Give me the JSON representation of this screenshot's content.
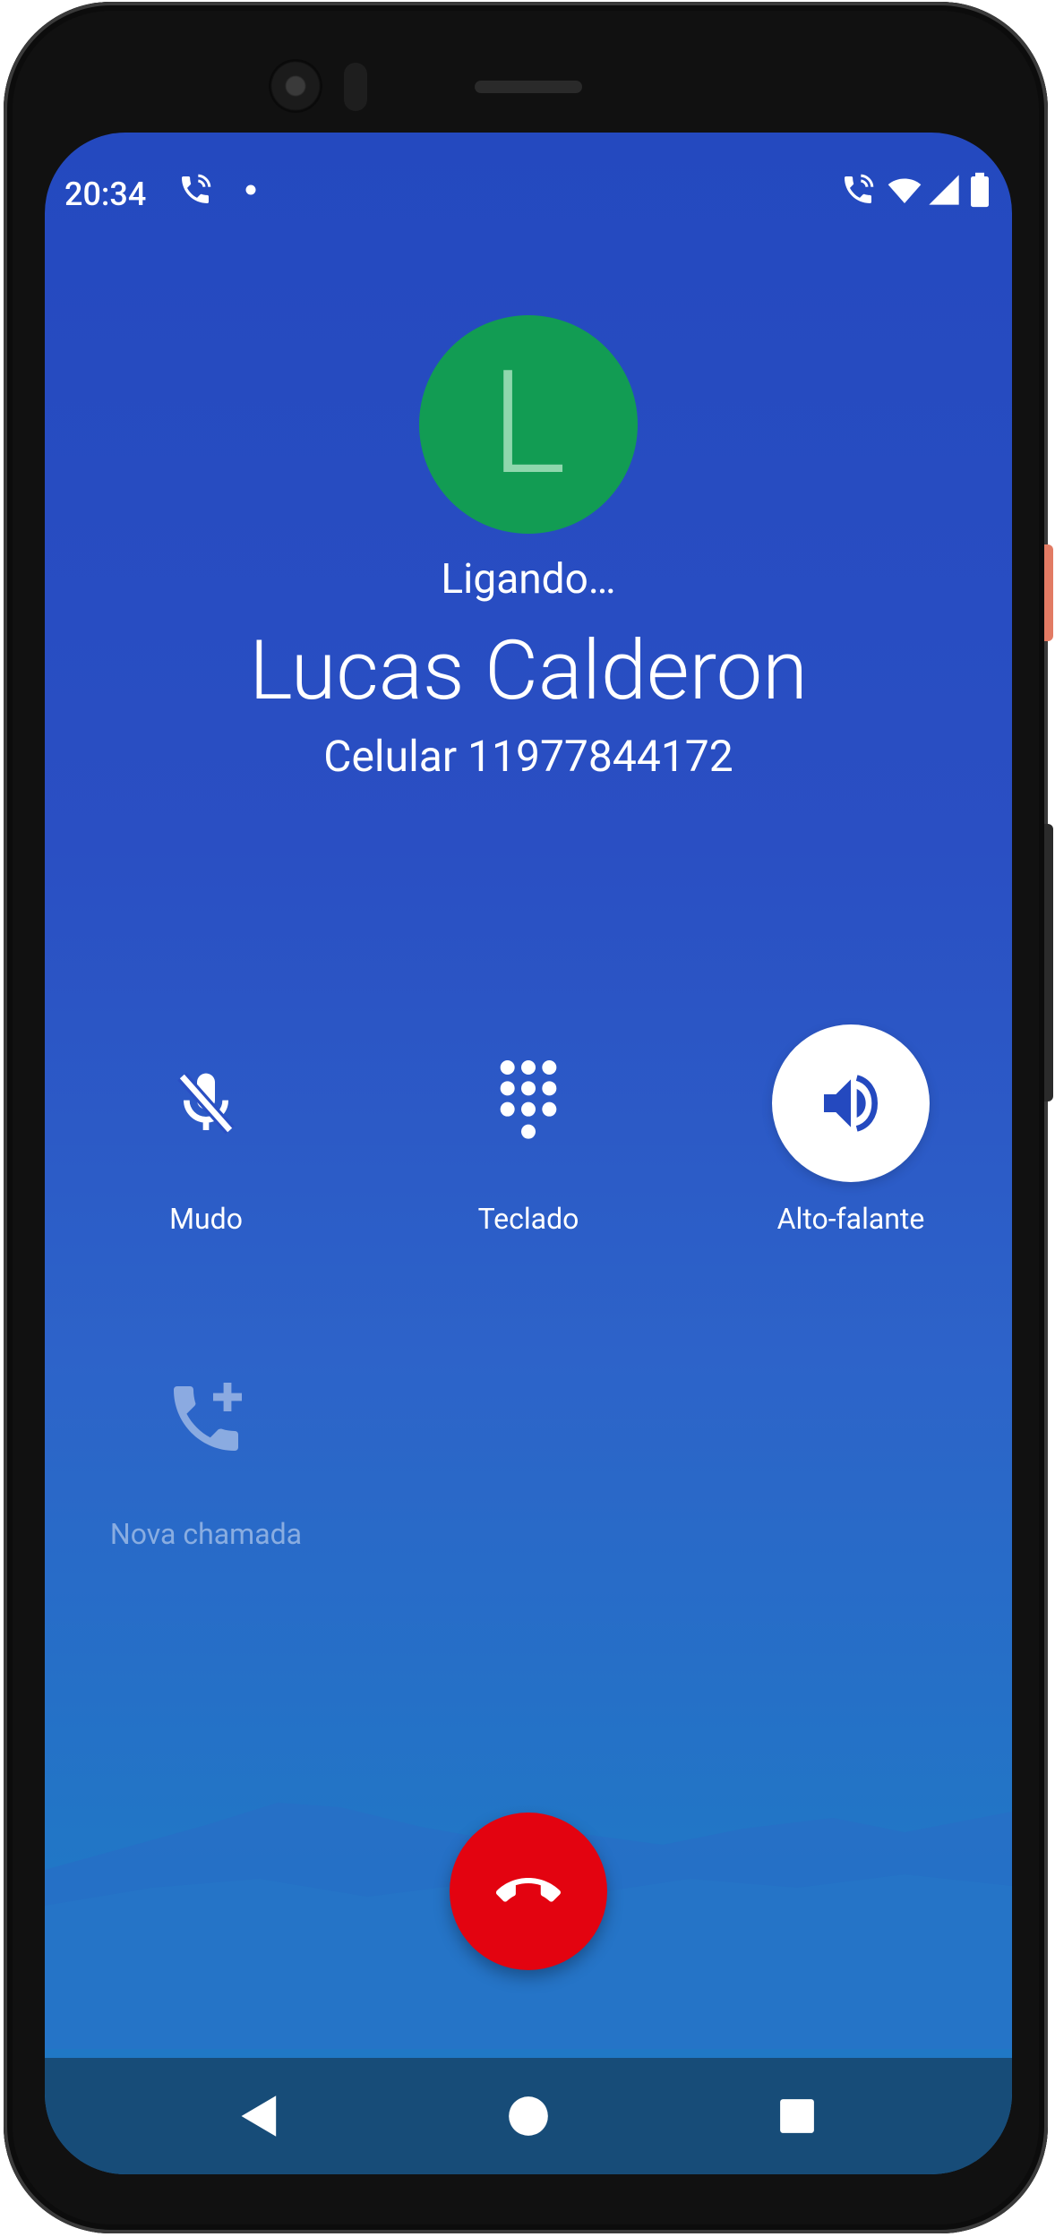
{
  "status_bar": {
    "time": "20:34",
    "icons": [
      "call-active-icon",
      "notification-dot-icon",
      "call-active-icon",
      "wifi-icon",
      "signal-icon",
      "battery-icon"
    ]
  },
  "call": {
    "avatar_letter": "L",
    "avatar_color": "#129c53",
    "state": "Ligando…",
    "contact_name": "Lucas Calderon",
    "contact_number": "Celular 11977844172"
  },
  "controls": {
    "mute": {
      "label": "Mudo",
      "icon": "mic-off-icon",
      "active": false
    },
    "keypad": {
      "label": "Teclado",
      "icon": "dialpad-icon",
      "active": false
    },
    "speaker": {
      "label": "Alto-falante",
      "icon": "speaker-icon",
      "active": true
    },
    "add_call": {
      "label": "Nova chamada",
      "icon": "add-call-icon",
      "enabled": false
    }
  },
  "end_call": {
    "icon": "call-end-icon",
    "color": "#e30310"
  },
  "navigation": {
    "back": "back-icon",
    "home": "home-icon",
    "recents": "recents-icon"
  },
  "colors": {
    "background_top": "#2449bf",
    "background_bottom": "#2078c4",
    "navbar": "#174c78"
  }
}
